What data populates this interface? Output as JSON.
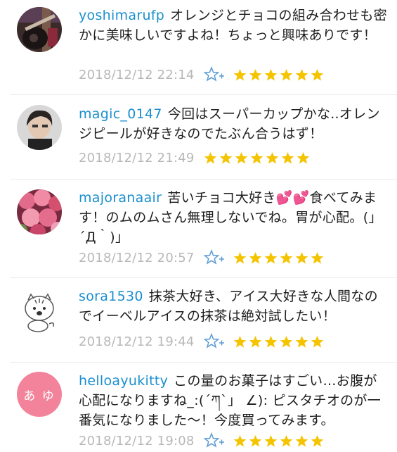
{
  "comments": [
    {
      "username": "yoshimarufp",
      "text": "オレンジとチョコの組み合わせも密かに美味しいですよね！ちょっと興味ありです！",
      "date": "2018/12/12 22:14",
      "stars": 6,
      "avatar_desc": "guitar photo"
    },
    {
      "username": "magic_0147",
      "text": "今回はスーパーカップかな..オレンジピールが好きなのでたぶん合うはず！",
      "date": "2018/12/12 21:49",
      "stars": 7,
      "avatar_desc": "person photo"
    },
    {
      "username": "majoranaair",
      "text": "苦いチョコ大好き💕💕食べてみます！のムのムさん無理しないでね。胃が心配。(」´Д｀)」",
      "date": "2018/12/12 20:57",
      "stars": 6,
      "avatar_desc": "roses photo"
    },
    {
      "username": "sora1530",
      "text": "抹茶大好き、アイス大好きな人間なのでイーベルアイスの抹茶は絶対試したい！",
      "date": "2018/12/12 19:44",
      "stars": 6,
      "avatar_desc": "tiger illustration"
    },
    {
      "username": "helloayukitty",
      "text": "この量のお菓子はすごい…お腹が心配になりますね_:(´ཀ`」 ∠): ピスタチオのが一番気になりました〜！今度買ってみます。",
      "date": "2018/12/12 19:08",
      "stars": 6,
      "avatar_text": "あ ゆ"
    }
  ],
  "colors": {
    "username": "#1a8fcf",
    "star": "#f5c400",
    "date": "#b8b8b8",
    "avatar_pink": "#f2839a"
  }
}
